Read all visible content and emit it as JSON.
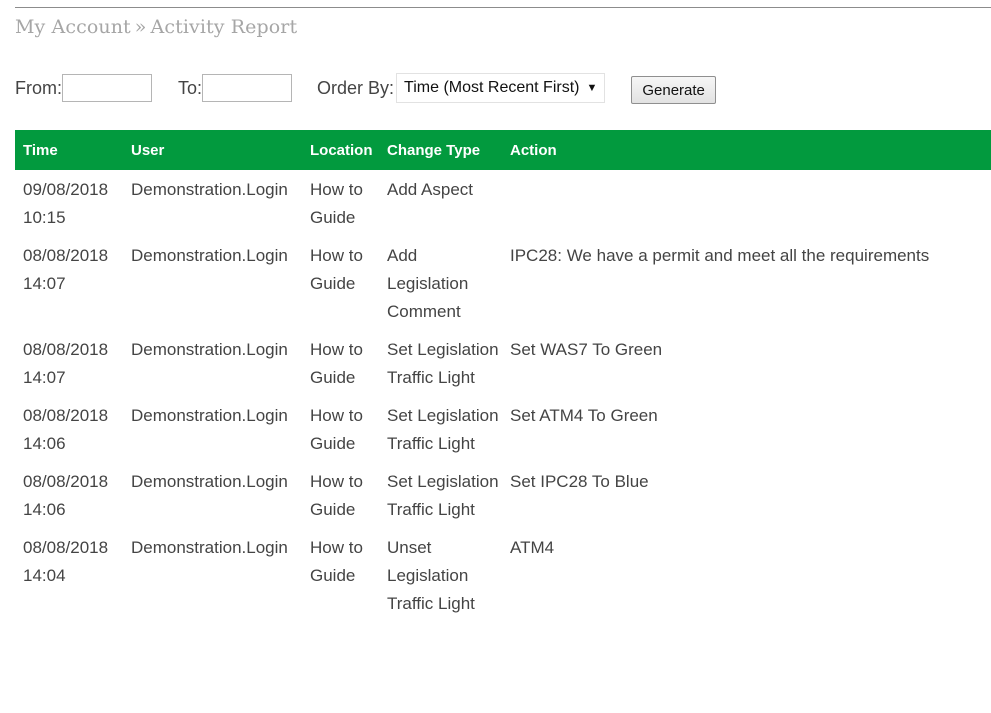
{
  "breadcrumb": {
    "parent": "My Account",
    "separator": "»",
    "current": "Activity Report"
  },
  "filters": {
    "from_label": "From:",
    "from_value": "",
    "to_label": "To:",
    "to_value": "",
    "order_label": "Order By:",
    "order_selected": "Time (Most Recent First)",
    "order_arrow": "▼",
    "generate_label": "Generate"
  },
  "table": {
    "columns": [
      "Time",
      "User",
      "Location",
      "Change Type",
      "Action"
    ],
    "rows": [
      {
        "time": "09/08/2018 10:15",
        "user": "Demonstration.Login",
        "location": "How to Guide",
        "change_type": "Add Aspect",
        "action": ""
      },
      {
        "time": "08/08/2018 14:07",
        "user": "Demonstration.Login",
        "location": "How to Guide",
        "change_type": "Add Legislation Comment",
        "action": "IPC28: We have a permit and meet all the requirements"
      },
      {
        "time": "08/08/2018 14:07",
        "user": "Demonstration.Login",
        "location": "How to Guide",
        "change_type": "Set Legislation Traffic Light",
        "action": "Set WAS7 To Green"
      },
      {
        "time": "08/08/2018 14:06",
        "user": "Demonstration.Login",
        "location": "How to Guide",
        "change_type": "Set Legislation Traffic Light",
        "action": "Set ATM4 To Green"
      },
      {
        "time": "08/08/2018 14:06",
        "user": "Demonstration.Login",
        "location": "How to Guide",
        "change_type": "Set Legislation Traffic Light",
        "action": "Set IPC28 To Blue"
      },
      {
        "time": "08/08/2018 14:04",
        "user": "Demonstration.Login",
        "location": "How to Guide",
        "change_type": "Unset Legislation Traffic Light",
        "action": "ATM4"
      }
    ]
  },
  "colors": {
    "header_bg": "#029a3e",
    "header_text": "#ffffff",
    "body_text": "#444444",
    "breadcrumb_text": "#a6a6a6"
  }
}
